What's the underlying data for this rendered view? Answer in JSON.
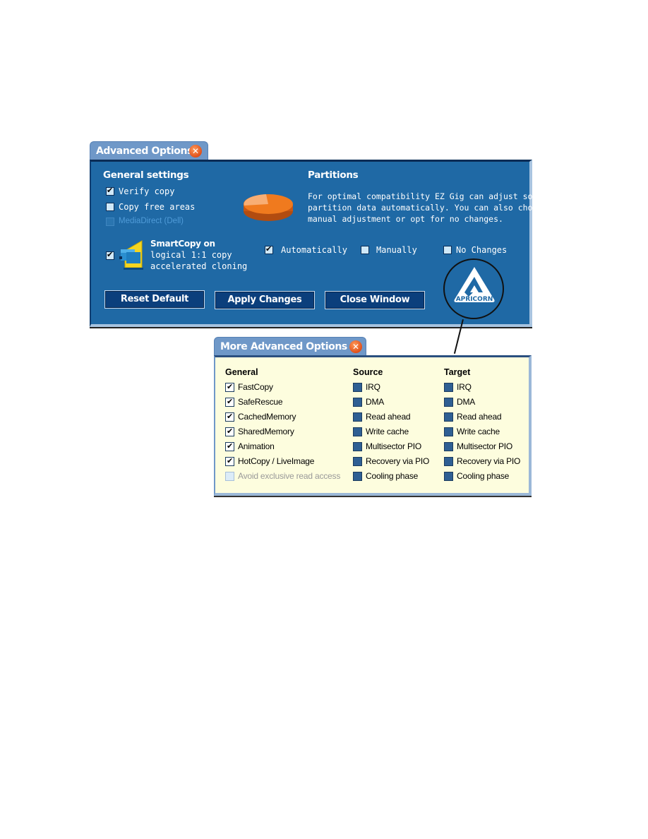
{
  "advanced_options": {
    "title": "Advanced Options",
    "close_icon": "close-icon",
    "general_settings": {
      "heading": "General settings",
      "items": [
        {
          "label": "Verify copy",
          "checked": true,
          "enabled": true
        },
        {
          "label": "Copy free areas",
          "checked": false,
          "enabled": true
        },
        {
          "label": "MediaDirect (Dell)",
          "checked": false,
          "enabled": false
        }
      ]
    },
    "smartcopy": {
      "checked": true,
      "icon": "smartcopy-icon",
      "title": "SmartCopy on",
      "line1": "logical 1:1 copy",
      "line2": "accelerated cloning"
    },
    "partitions": {
      "heading": "Partitions",
      "icon": "pie-chart-icon",
      "description_lines": [
        "For optimal compatibility EZ Gig can adjust some",
        "partition data automatically. You can also choose",
        "manual adjustment or opt for no changes."
      ],
      "options": [
        {
          "label": "Automatically",
          "checked": true
        },
        {
          "label": "Manually",
          "checked": false
        },
        {
          "label": "No Changes",
          "checked": false
        }
      ]
    },
    "buttons": {
      "reset": "Reset Default",
      "apply": "Apply Changes",
      "close": "Close Window"
    },
    "logo_text": "APRICORN"
  },
  "more_advanced_options": {
    "title": "More Advanced Options",
    "close_icon": "close-icon",
    "general": {
      "heading": "General",
      "items": [
        {
          "label": "FastCopy",
          "checked": true,
          "enabled": true
        },
        {
          "label": "SafeRescue",
          "checked": true,
          "enabled": true
        },
        {
          "label": "CachedMemory",
          "checked": true,
          "enabled": true
        },
        {
          "label": "SharedMemory",
          "checked": true,
          "enabled": true
        },
        {
          "label": "Animation",
          "checked": true,
          "enabled": true
        },
        {
          "label": "HotCopy / LiveImage",
          "checked": true,
          "enabled": true
        },
        {
          "label": "Avoid exclusive read access",
          "checked": false,
          "enabled": false
        }
      ]
    },
    "source": {
      "heading": "Source",
      "items": [
        {
          "label": "IRQ"
        },
        {
          "label": "DMA"
        },
        {
          "label": "Read ahead"
        },
        {
          "label": "Write cache"
        },
        {
          "label": "Multisector PIO"
        },
        {
          "label": "Recovery via PIO"
        },
        {
          "label": "Cooling phase"
        }
      ]
    },
    "target": {
      "heading": "Target",
      "items": [
        {
          "label": "IRQ"
        },
        {
          "label": "DMA"
        },
        {
          "label": "Read ahead"
        },
        {
          "label": "Write cache"
        },
        {
          "label": "Multisector PIO"
        },
        {
          "label": "Recovery via PIO"
        },
        {
          "label": "Cooling phase"
        }
      ]
    }
  },
  "colors": {
    "window_blue": "#1f69a5",
    "tab_blue": "#6f98c8",
    "button_navy": "#0b3f7c",
    "panel_cream": "#fdfdde",
    "close_orange": "#e0501a",
    "pie_orange": "#f07a1e"
  }
}
